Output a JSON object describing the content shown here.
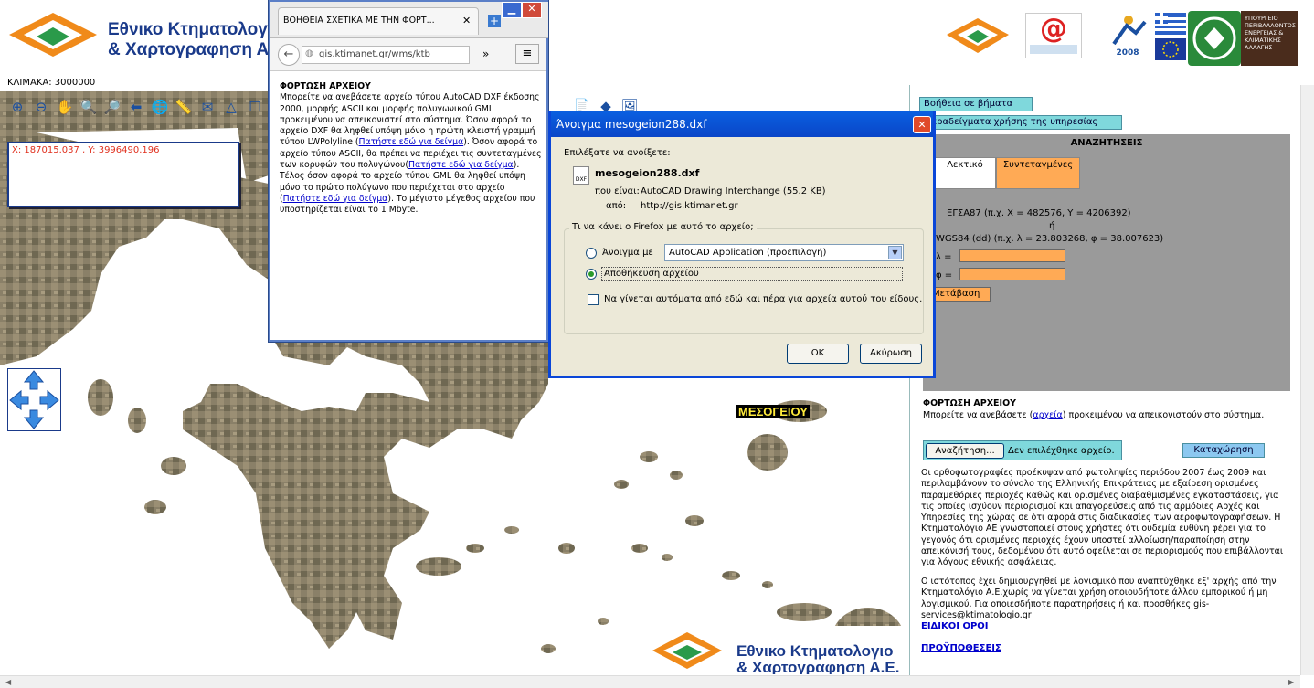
{
  "header": {
    "logo_line1": "Εθνικο Κτηματολογιο",
    "logo_line2": "& Χαρτογραφηση Α.Ε.",
    "scale_label": "ΚΛΙΜΑΚΑ: 3000000"
  },
  "coords": {
    "text": "X: 187015.037 , Y: 3996490.196"
  },
  "map": {
    "region_label": "ΜΕΣΟΓΕΙΟΥ"
  },
  "right_panel": {
    "help_steps_btn": "Βοήθεια σε βήματα",
    "examples_btn": "Παραδείγματα χρήσης της υπηρεσίας",
    "search_title": "ΑΝΑΖΗΤΗΣΕΙΣ",
    "tab_lexical": "Λεκτικό",
    "tab_coords": "Συντεταγμένες",
    "egsa_hint": "ΕΓΣΑ87 (π.χ. X = 482576, Y = 4206392)",
    "or": "ή",
    "wgs_hint": "WGS84 (dd) (π.χ. λ = 23.803268, φ = 38.007623)",
    "lambda_label": "λ =",
    "phi_label": "φ =",
    "go_btn": "Μετάβαση",
    "upload_title": "ΦΟΡΤΩΣΗ ΑΡΧΕΙΟΥ",
    "upload_text_pre": "Μπορείτε να ανεβάσετε (",
    "upload_link": "αρχεία",
    "upload_text_post": ") προκειμένου να απεικονιστούν στο σύστημα.",
    "browse_btn": "Αναζήτηση...",
    "no_file": "Δεν επιλέχθηκε αρχείο.",
    "submit_btn": "Καταχώρηση",
    "disclaimer": "Οι ορθοφωτογραφίες προέκυψαν από φωτοληψίες περιόδου 2007 έως 2009 και περιλαμβάνουν το σύνολο της Ελληνικής Επικράτειας με εξαίρεση ορισμένες παραμεθόριες περιοχές καθώς και ορισμένες διαβαθμισμένες εγκαταστάσεις, για τις οποίες ισχύουν περιορισμοί και απαγορεύσεις από τις αρμόδιες Αρχές και Υπηρεσίες της χώρας σε ότι αφορά στις διαδικασίες των αεροφωτογραφήσεων. Η Κτηματολόγιο ΑΕ γνωστοποιεί στους χρήστες ότι ουδεμία ευθύνη φέρει για το γεγονός ότι ορισμένες περιοχές έχουν υποστεί αλλοίωση/παραποίηση στην απεικόνισή τους, δεδομένου ότι αυτό οφείλεται σε περιορισμούς που επιβάλλονται για λόγους εθνικής ασφάλειας.",
    "disclaimer2": "Ο ιστότοπος έχει δημιουργηθεί με λογισμικό που αναπτύχθηκε εξ' αρχής από την Κτηματολόγιο Α.Ε.χωρίς να γίνεται χρήση οποιουδήποτε άλλου εμπορικού ή μη λογισμικού. Για οποιεσδήποτε παρατηρήσεις ή και προσθήκες gis-services@ktimatologio.gr",
    "terms_link": "ΕΙΔΙΚΟΙ ΟΡΟΙ",
    "prereq_link": "ΠΡΟΫΠΟΘΕΣΕΙΣ"
  },
  "popup": {
    "tab_title": "ΒΟΗΘΕΙΑ ΣΧΕΤΙΚΑ ΜΕ ΤΗΝ ΦΟΡΤ...",
    "url": "gis.ktimanet.gr/wms/ktb",
    "heading": "ΦΟΡΤΩΣΗ ΑΡΧΕΙΟΥ",
    "p1": "Μπορείτε να ανεβάσετε αρχείο τύπου AutoCAD DXF έκδοσης 2000, μορφής ASCII και μορφής πολυγωνικού GML προκειμένου να απεικονιστεί στο σύστημα. Όσον αφορά το αρχείο DXF θα ληφθεί υπόψη μόνο η πρώτη κλειστή γραμμή τύπου LWPolyline (",
    "link1": "Πατήστε εδώ για δείγμα",
    "p2": "). Όσον αφορά το αρχείο τύπου ASCII, θα πρέπει να περιέχει τις συντεταγμένες των κορυφών του πολυγώνου(",
    "link2": "Πατήστε εδώ για δείγμα",
    "p3": "). Τέλος όσον αφορά το αρχείο τύπου GML θα ληφθεί υπόψη μόνο το πρώτο πολύγωνο που περιέχεται στο αρχείο (",
    "link3": "Πατήστε εδώ για δείγμα",
    "p4": "). Το μέγιστο μέγεθος αρχείου που υποστηρίζεται είναι το 1 Mbyte."
  },
  "dialog": {
    "title": "Άνοιγμα mesogeion288.dxf",
    "chosen_label": "Επιλέξατε να ανοίξετε:",
    "filename": "mesogeion288.dxf",
    "type_label": "που είναι:",
    "type_value": "AutoCAD Drawing Interchange (55.2 KB)",
    "from_label": "από:",
    "from_value": "http://gis.ktimanet.gr",
    "question": "Τι να κάνει ο Firefox  με αυτό το αρχείο;",
    "open_with_label": "Άνοιγμα με",
    "open_with_value": "AutoCAD Application (προεπιλογή)",
    "save_label": "Αποθήκευση αρχείου",
    "auto_label": "Να γίνεται αυτόματα από εδώ και πέρα για αρχεία αυτού του είδους.",
    "ok": "OK",
    "cancel": "Ακύρωση",
    "dxf_icon_text": "DXF"
  },
  "logos": {
    "at_symbol": "@",
    "greece_year": "2008",
    "ministry": "ΥΠΟΥΡΓΕΙΟ ΠΕΡΙΒΑΛΛΟΝΤΟΣ ΕΝΕΡΓΕΙΑΣ & ΚΛΙΜΑΤΙΚΗΣ ΑΛΛΑΓΗΣ"
  },
  "colors": {
    "accent_cyan": "#7fd8dc",
    "accent_orange": "#ffaa55",
    "xp_blue": "#0a46d8",
    "brand_blue": "#1a3a8a"
  }
}
